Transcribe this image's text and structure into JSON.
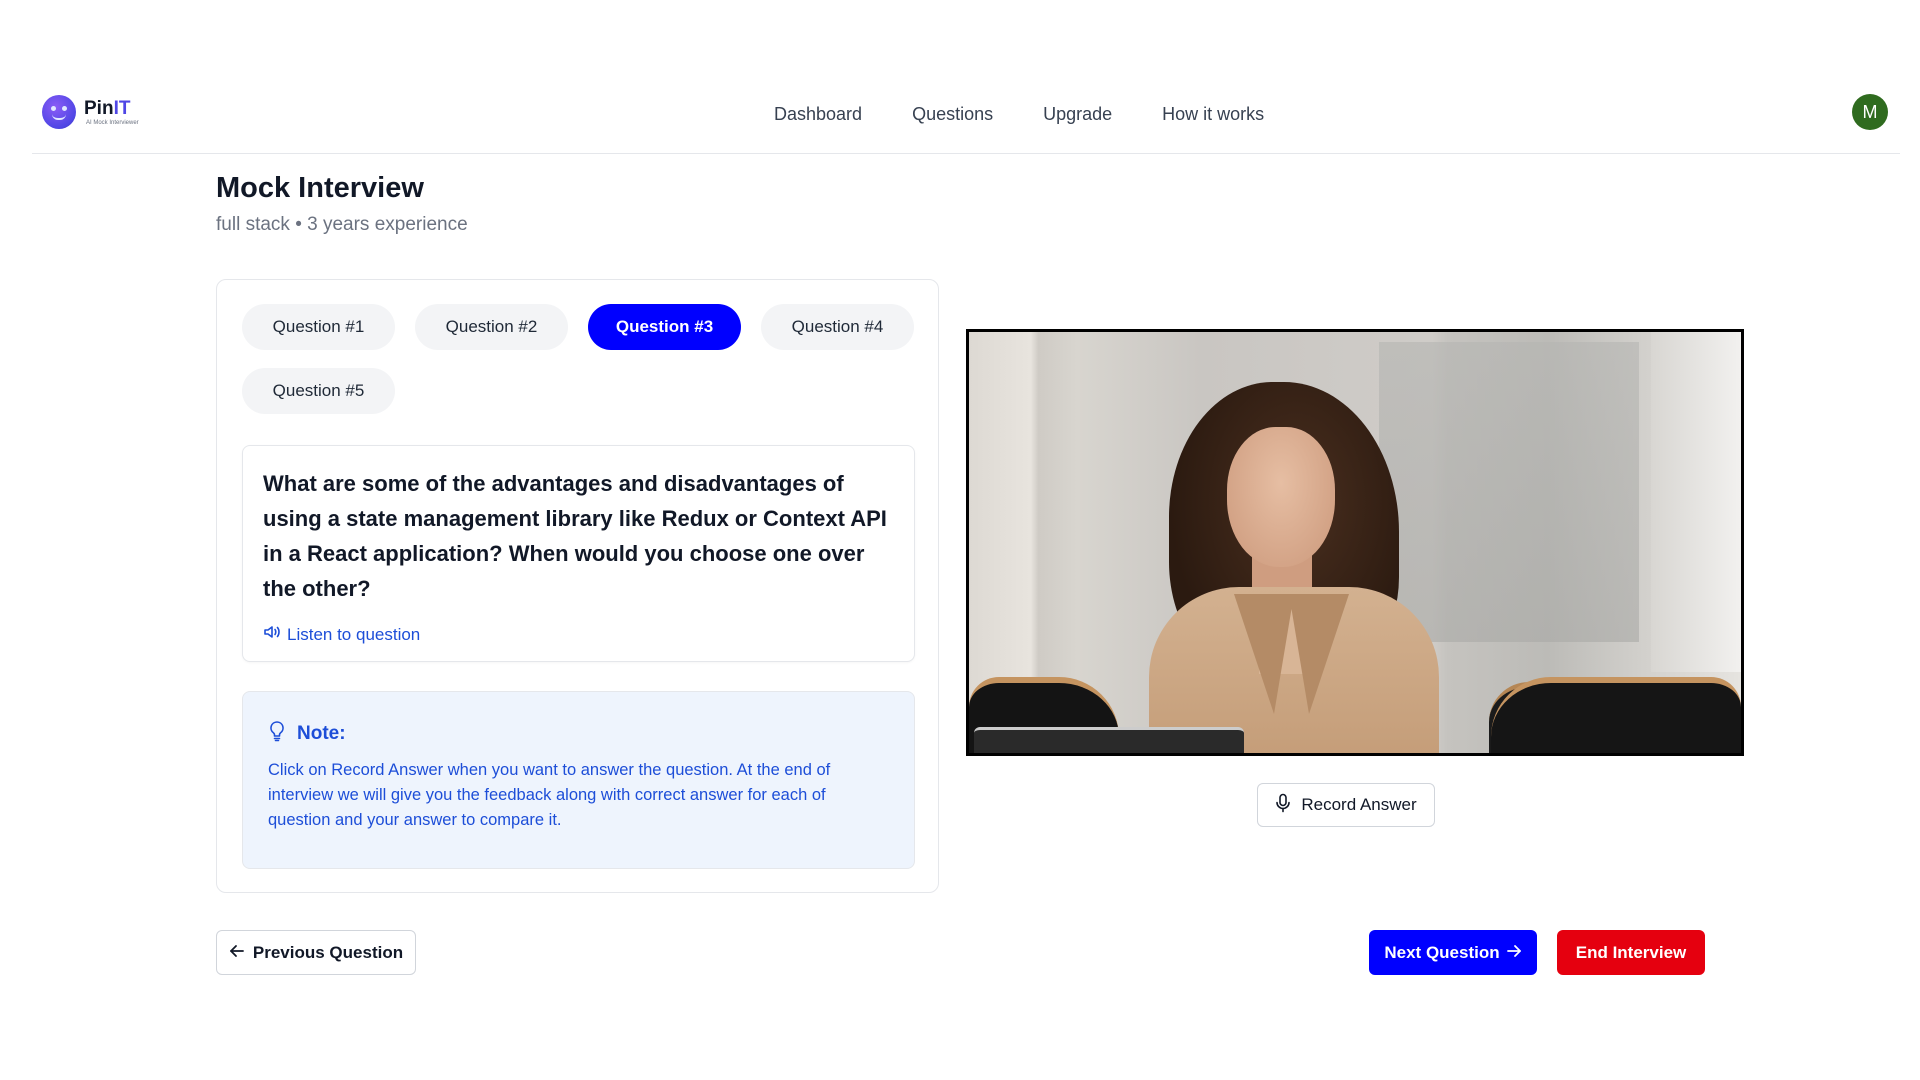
{
  "brand": {
    "name_main": "Pin",
    "name_accent": "IT",
    "tagline": "AI Mock Interviewer"
  },
  "nav": {
    "items": [
      {
        "label": "Dashboard"
      },
      {
        "label": "Questions"
      },
      {
        "label": "Upgrade"
      },
      {
        "label": "How it works"
      }
    ]
  },
  "user": {
    "avatar_initial": "M"
  },
  "page": {
    "title": "Mock Interview",
    "subtitle": "full stack • 3 years experience"
  },
  "questions": {
    "tabs": [
      {
        "label": "Question #1"
      },
      {
        "label": "Question #2"
      },
      {
        "label": "Question #3"
      },
      {
        "label": "Question #4"
      },
      {
        "label": "Question #5"
      }
    ],
    "active_index": 2,
    "current_text": "What are some of the advantages and disadvantages of using a state management library like Redux or Context API in a React application? When would you choose one over the other?",
    "listen_label": "Listen to question"
  },
  "note": {
    "title": "Note:",
    "text": "Click on Record Answer when you want to answer the question. At the end of interview we will give you the feedback along with correct answer for each of question and your answer to compare it."
  },
  "video": {
    "record_label": "Record Answer"
  },
  "footer": {
    "previous_label": "Previous Question",
    "next_label": "Next Question",
    "end_label": "End Interview"
  },
  "colors": {
    "primary": "#0000ff",
    "danger": "#e5000f",
    "note_bg": "#eef4fd",
    "note_text": "#1d4ed8",
    "avatar_bg": "#2f6b1f"
  },
  "icons": [
    "logo-icon",
    "speaker-icon",
    "lightbulb-icon",
    "microphone-icon",
    "arrow-left-icon",
    "arrow-right-icon"
  ]
}
